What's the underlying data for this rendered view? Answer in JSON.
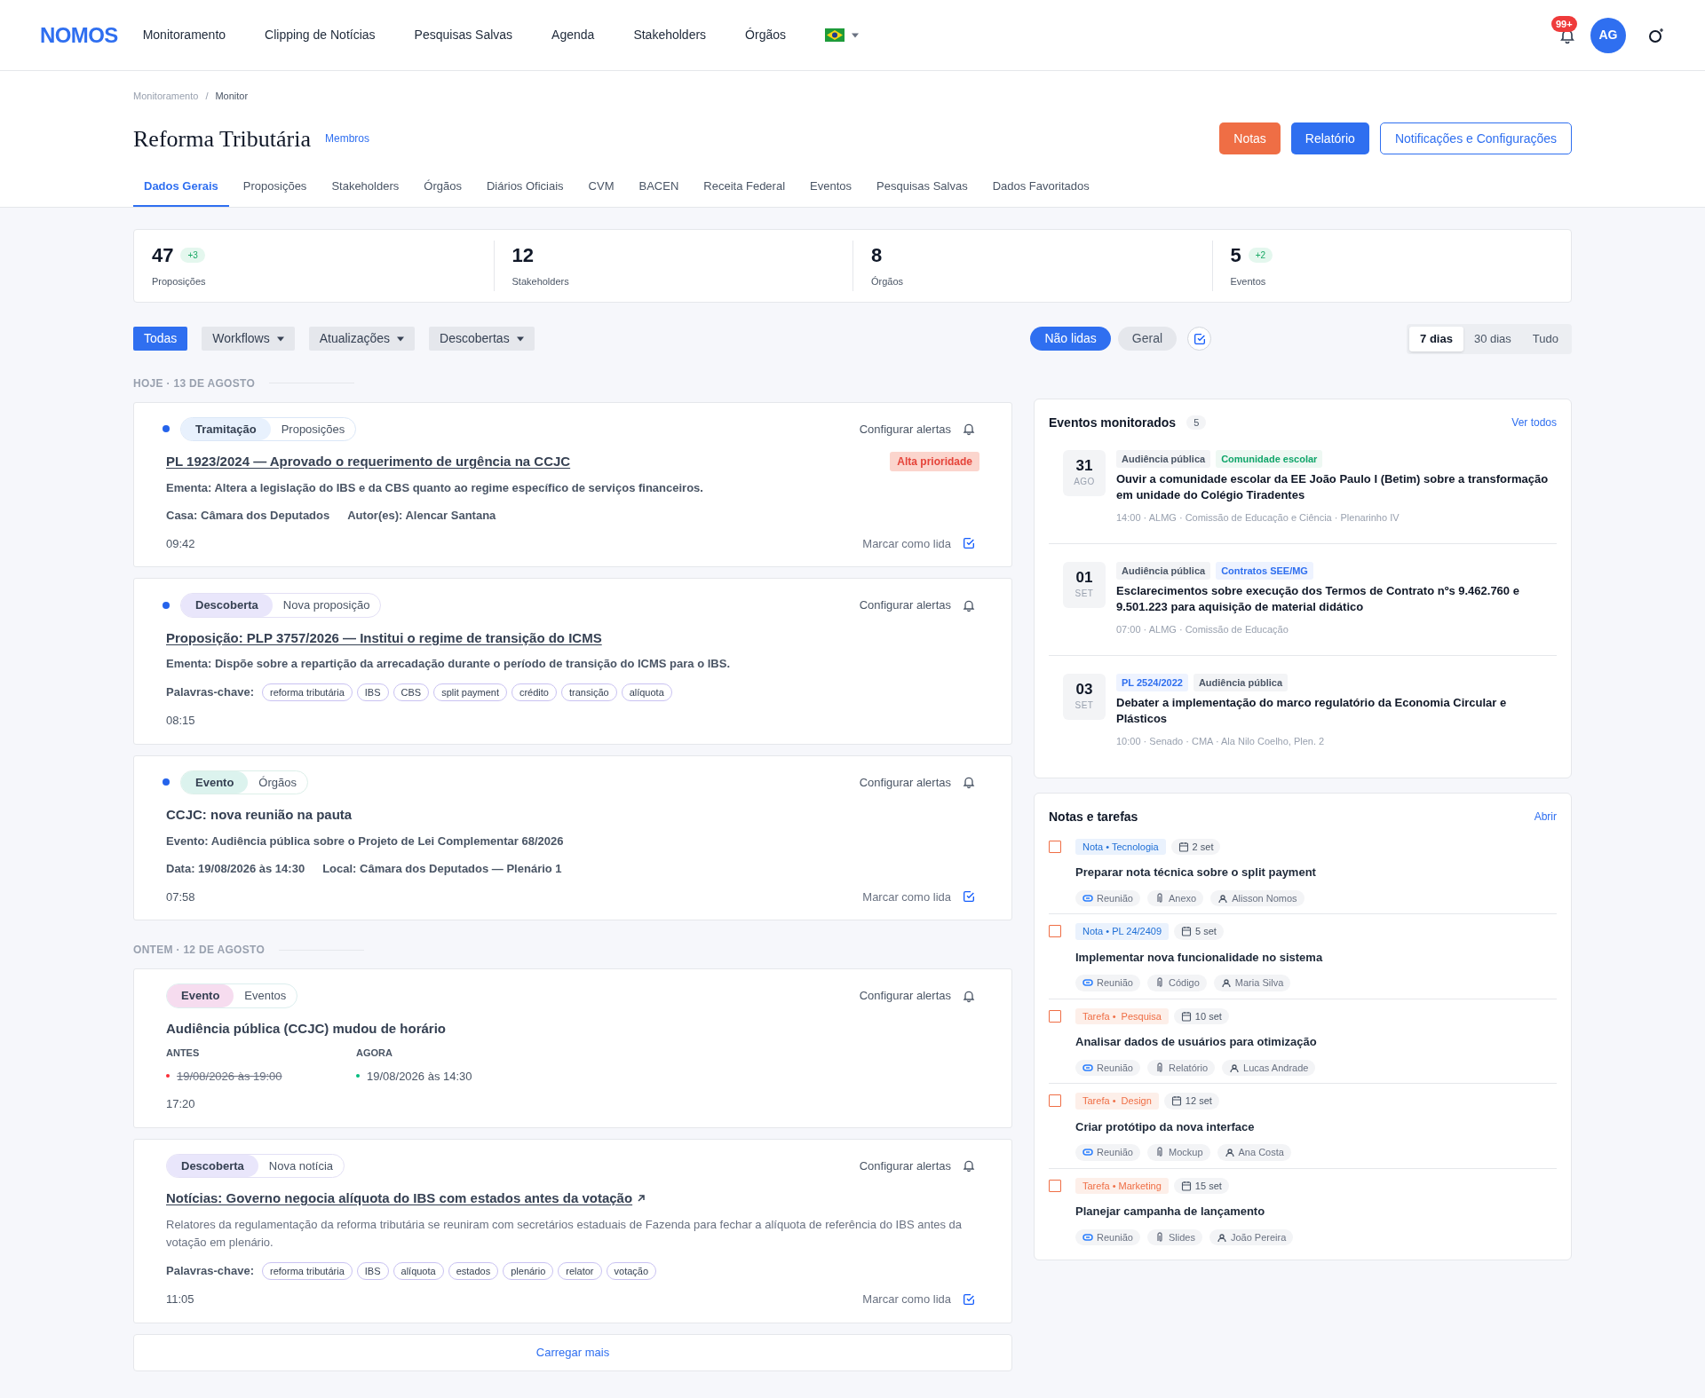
{
  "nav": {
    "brand": "NOMOS",
    "items": [
      "Monitoramento",
      "Clipping de Notícias",
      "Pesquisas Salvas",
      "Agenda",
      "Stakeholders",
      "Órgãos"
    ],
    "badge": "99+",
    "avatar": "AG"
  },
  "breadcrumb": [
    "Monitoramento",
    "Monitor"
  ],
  "breadcrumb_separator": "/",
  "title": "Reforma Tributária",
  "members_link": "Membros",
  "actions": [
    {
      "label": "Notas",
      "kind": "accent"
    },
    {
      "label": "Relatório",
      "kind": "primary"
    },
    {
      "label": "Notificações e Configurações",
      "kind": "outline"
    }
  ],
  "tabs": [
    {
      "label": "Dados Gerais",
      "selected": true
    },
    {
      "label": "Proposições",
      "selected": false
    },
    {
      "label": "Stakeholders",
      "selected": false
    },
    {
      "label": "Órgãos",
      "selected": false
    },
    {
      "label": "Diários Oficiais",
      "selected": false
    },
    {
      "label": "CVM",
      "selected": false
    },
    {
      "label": "BACEN",
      "selected": false
    },
    {
      "label": "Receita Federal",
      "selected": false
    },
    {
      "label": "Eventos",
      "selected": false
    },
    {
      "label": "Pesquisas Salvas",
      "selected": false
    },
    {
      "label": "Dados Favoritados",
      "selected": false
    }
  ],
  "stats": [
    {
      "value": "47",
      "label": "Proposições",
      "delta": "+3"
    },
    {
      "value": "12",
      "label": "Stakeholders"
    },
    {
      "value": "8",
      "label": "Órgãos"
    },
    {
      "value": "5",
      "label": "Eventos",
      "delta": "+2"
    }
  ],
  "filters": [
    {
      "label": "Todas",
      "selected": true,
      "dropdown": false
    },
    {
      "label": "Workflows",
      "selected": false,
      "dropdown": true
    },
    {
      "label": "Atualizações",
      "selected": false,
      "dropdown": true
    },
    {
      "label": "Descobertas",
      "selected": false,
      "dropdown": true
    }
  ],
  "read_filters": [
    {
      "label": "Não lidas",
      "selected": true
    },
    {
      "label": "Geral",
      "selected": false
    }
  ],
  "periods": [
    {
      "label": "7 dias",
      "selected": true
    },
    {
      "label": "30 dias",
      "selected": false
    },
    {
      "label": "Tudo",
      "selected": false
    }
  ],
  "feed": [
    {
      "heading": "HOJE · 13 DE AGOSTO",
      "cards": [
        {
          "unread": true,
          "kind": "blue",
          "category": "Tramitação",
          "source": "Proposições",
          "alert": "Configurar alertas",
          "title": "PL 1923/2024 — Aprovado o requerimento de urgência na CCJC",
          "link": true,
          "external": false,
          "priority": "Alta prioridade",
          "lines": [
            "Ementa: Altera a legislação do IBS e da CBS quanto ao regime específico de serviços financeiros."
          ],
          "meta": [
            "Casa: Câmara dos Deputados",
            "Autor(es): Alencar Santana"
          ],
          "time": "09:42",
          "mark_read": "Marcar como lida"
        },
        {
          "unread": true,
          "kind": "purple",
          "category": "Descoberta",
          "source": "Nova proposição",
          "alert": "Configurar alertas",
          "title": "Proposição: PLP 3757/2026 — Institui o regime de transição do ICMS",
          "link": true,
          "external": false,
          "lines": [
            "Ementa: Dispõe sobre a repartição da arrecadação durante o período de transição do ICMS para o IBS."
          ],
          "keywords_label": "Palavras-chave:",
          "keywords": [
            "reforma tributária",
            "IBS",
            "CBS",
            "split payment",
            "crédito",
            "transição",
            "alíquota"
          ],
          "time": "08:15"
        },
        {
          "unread": true,
          "kind": "teal",
          "category": "Evento",
          "source": "Órgãos",
          "alert": "Configurar alertas",
          "title": "CCJC: nova reunião na pauta",
          "link": false,
          "lines": [
            "Evento: Audiência pública sobre o Projeto de Lei Complementar 68/2026"
          ],
          "meta": [
            "Data: 19/08/2026 às 14:30",
            "Local: Câmara dos Deputados — Plenário 1"
          ],
          "time": "07:58",
          "mark_read": "Marcar como lida"
        }
      ]
    },
    {
      "heading": "ONTEM · 12 DE AGOSTO",
      "cards": [
        {
          "unread": false,
          "kind": "pink",
          "category": "Evento",
          "source": "Eventos",
          "alert": "Configurar alertas",
          "title": "Audiência pública (CCJC) mudou de horário",
          "link": false,
          "change": {
            "before_label": "ANTES",
            "before": "19/08/2026 às 19:00",
            "after_label": "AGORA",
            "after": "19/08/2026 às 14:30"
          },
          "time": "17:20"
        },
        {
          "unread": false,
          "kind": "purple",
          "category": "Descoberta",
          "source": "Nova notícia",
          "alert": "Configurar alertas",
          "title": "Notícias: Governo negocia alíquota do IBS com estados antes da votação",
          "link": true,
          "external": true,
          "description": "Relatores da regulamentação da reforma tributária se reuniram com secretários estaduais de Fazenda para fechar a alíquota de referência do IBS antes da votação em plenário.",
          "keywords_label": "Palavras-chave:",
          "keywords": [
            "reforma tributária",
            "IBS",
            "alíquota",
            "estados",
            "plenário",
            "relator",
            "votação"
          ],
          "time": "11:05",
          "mark_read": "Marcar como lida"
        }
      ]
    }
  ],
  "load_more": "Carregar mais",
  "events_panel": {
    "title": "Eventos monitorados",
    "count": "5",
    "link": "Ver todos",
    "events": [
      {
        "day": "31",
        "month": "AGO",
        "tags": [
          {
            "label": "Audiência pública",
            "kind": "gray"
          },
          {
            "label": "Comunidade escolar",
            "kind": "green"
          }
        ],
        "title": "Ouvir a comunidade escolar da EE João Paulo I (Betim) sobre a transformação em unidade do Colégio Tiradentes",
        "meta": "14:00 · ALMG · Comissão de Educação e Ciência · Plenarinho IV"
      },
      {
        "day": "01",
        "month": "SET",
        "tags": [
          {
            "label": "Audiência pública",
            "kind": "gray"
          },
          {
            "label": "Contratos SEE/MG",
            "kind": "blue"
          }
        ],
        "title": "Esclarecimentos sobre execução dos Termos de Contrato nºs 9.462.760 e 9.501.223 para aquisição de material didático",
        "meta": "07:00 · ALMG · Comissão de Educação"
      },
      {
        "day": "03",
        "month": "SET",
        "tags": [
          {
            "label": "PL 2524/2022",
            "kind": "blue"
          },
          {
            "label": "Audiência pública",
            "kind": "gray"
          }
        ],
        "title": "Debater a implementação do marco regulatório da Economia Circular e Plásticos",
        "meta": "10:00 · Senado · CMA · Ala Nilo Coelho, Plen. 2"
      }
    ]
  },
  "notes_panel": {
    "title": "Notas e tarefas",
    "link": "Abrir",
    "items": [
      {
        "checked": false,
        "kind": "note",
        "tag": "Nota • Tecnologia",
        "date": "2 set",
        "title": "Preparar nota técnica sobre o split payment",
        "chips": [
          "Reunião",
          "Anexo",
          "Alisson Nomos"
        ]
      },
      {
        "checked": false,
        "kind": "note",
        "tag": "Nota • PL 24/2409",
        "date": "5 set",
        "title": "Implementar nova funcionalidade no sistema",
        "chips": [
          "Reunião",
          "Código",
          "Maria Silva"
        ]
      },
      {
        "checked": false,
        "kind": "task",
        "tag": "Tarefa •  Pesquisa",
        "date": "10 set",
        "title": "Analisar dados de usuários para otimização",
        "chips": [
          "Reunião",
          "Relatório",
          "Lucas Andrade"
        ]
      },
      {
        "checked": false,
        "kind": "task",
        "tag": "Tarefa •  Design",
        "date": "12 set",
        "title": "Criar protótipo da nova interface",
        "chips": [
          "Reunião",
          "Mockup",
          "Ana Costa"
        ]
      },
      {
        "checked": false,
        "kind": "task",
        "tag": "Tarefa • Marketing",
        "date": "15 set",
        "title": "Planejar campanha de lançamento",
        "chips": [
          "Reunião",
          "Slides",
          "João Pereira"
        ]
      }
    ]
  }
}
